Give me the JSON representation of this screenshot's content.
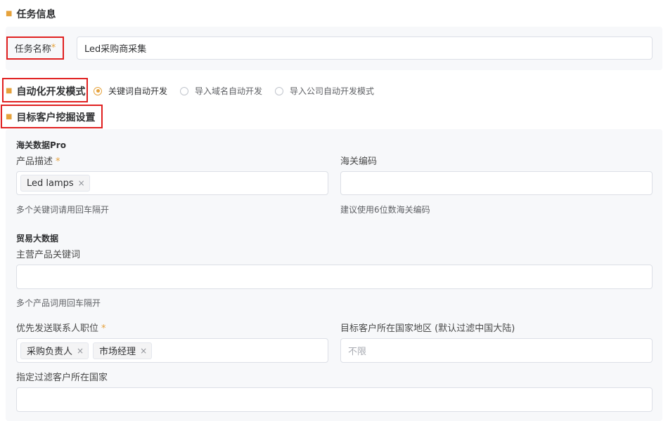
{
  "section_task_info": {
    "title": "任务信息"
  },
  "task_name": {
    "label": "任务名称",
    "required_mark": "*",
    "value": "Led采购商采集"
  },
  "dev_mode": {
    "title": "自动化开发模式",
    "options": [
      "关键词自动开发",
      "导入域名自动开发",
      "导入公司自动开发模式"
    ],
    "selected": "关键词自动开发"
  },
  "target_settings": {
    "title": "目标客户挖掘设置",
    "customs_pro": {
      "group_title": "海关数据Pro",
      "product_desc": {
        "label": "产品描述",
        "required_mark": "*",
        "tags": [
          "Led lamps"
        ],
        "hint": "多个关键词请用回车隔开"
      },
      "hs_code": {
        "label": "海关编码",
        "value": "",
        "hint": "建议使用6位数海关编码"
      }
    },
    "trade_data": {
      "group_title": "贸易大数据",
      "main_products": {
        "label": "主营产品关键词",
        "value": "",
        "hint": "多个产品词用回车隔开"
      }
    },
    "contact_position": {
      "label": "优先发送联系人职位",
      "required_mark": "*",
      "tags": [
        "采购负责人",
        "市场经理"
      ]
    },
    "target_region": {
      "label": "目标客户所在国家地区 (默认过滤中国大陆)",
      "placeholder": "不限"
    },
    "filter_country": {
      "label": "指定过滤客户所在国家",
      "value": ""
    }
  },
  "colors": {
    "accent": "#e6a23c",
    "highlight": "#e02020",
    "panel_bg": "#f7f8fa"
  }
}
